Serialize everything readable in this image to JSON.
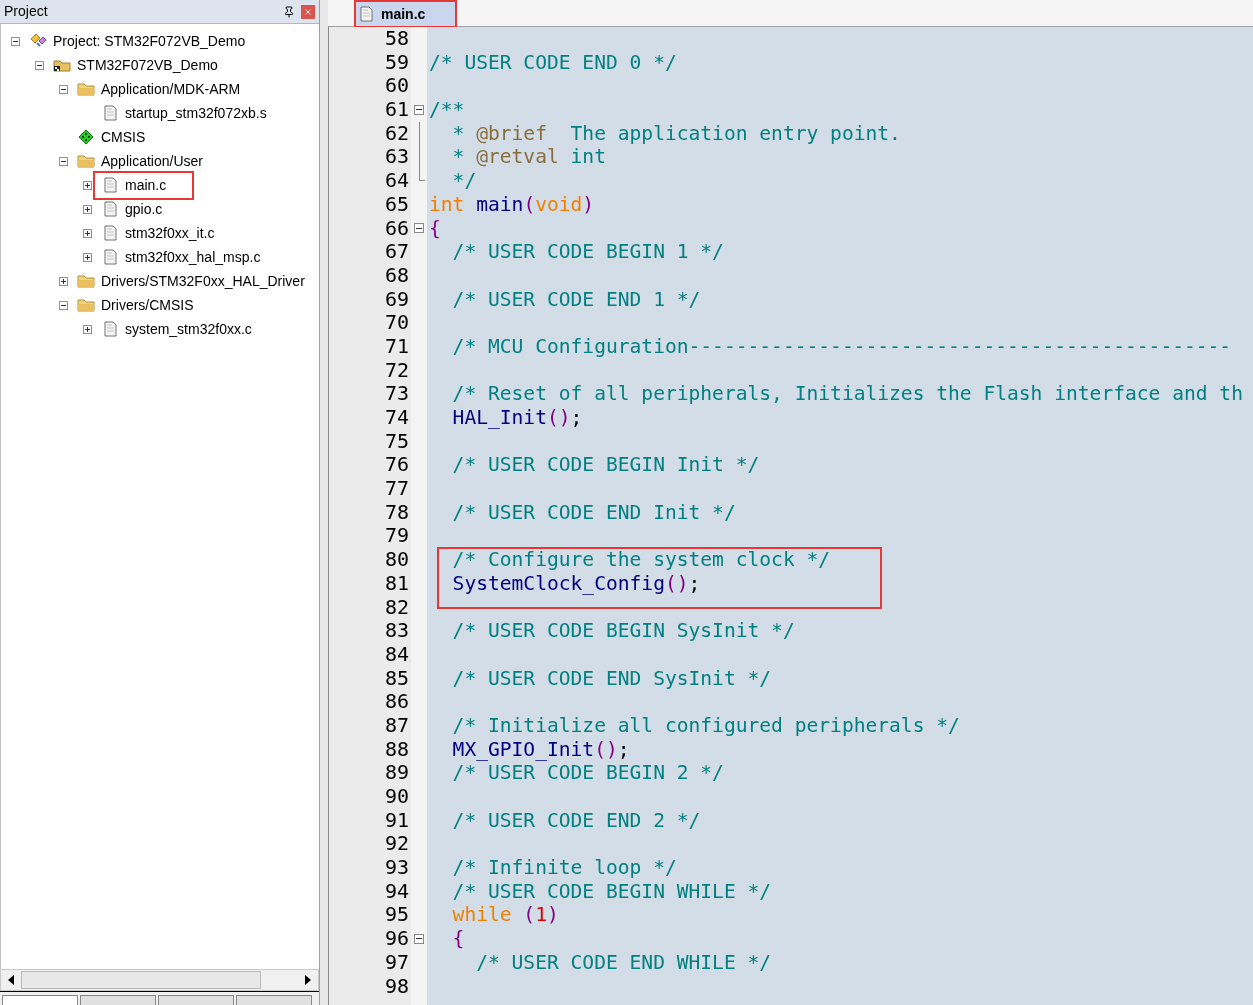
{
  "project_panel": {
    "title": "Project",
    "tree": [
      {
        "label": "Project: STM32F072VB_Demo",
        "kind": "project",
        "expanded": true,
        "children": [
          {
            "label": "STM32F072VB_Demo",
            "kind": "target",
            "expanded": true,
            "children": [
              {
                "label": "Application/MDK-ARM",
                "kind": "folder",
                "expanded": true,
                "children": [
                  {
                    "label": "startup_stm32f072xb.s",
                    "kind": "file"
                  }
                ]
              },
              {
                "label": "CMSIS",
                "kind": "component"
              },
              {
                "label": "Application/User",
                "kind": "folder",
                "expanded": true,
                "children": [
                  {
                    "label": "main.c",
                    "kind": "file",
                    "expanded": false,
                    "highlighted": true
                  },
                  {
                    "label": "gpio.c",
                    "kind": "file",
                    "expanded": false,
                    "highlighted": false
                  },
                  {
                    "label": "stm32f0xx_it.c",
                    "kind": "file",
                    "expanded": false,
                    "highlighted": false
                  },
                  {
                    "label": "stm32f0xx_hal_msp.c",
                    "kind": "file",
                    "expanded": false,
                    "highlighted": false
                  }
                ]
              },
              {
                "label": "Drivers/STM32F0xx_HAL_Driver",
                "kind": "folder",
                "expanded": false
              },
              {
                "label": "Drivers/CMSIS",
                "kind": "folder",
                "expanded": true,
                "children": [
                  {
                    "label": "system_stm32f0xx.c",
                    "kind": "file",
                    "expanded": false
                  }
                ]
              }
            ]
          }
        ]
      }
    ],
    "bottom_tabs": [
      {
        "selected": true
      },
      {
        "selected": false
      },
      {
        "selected": false
      },
      {
        "selected": false
      }
    ]
  },
  "editor": {
    "tabs": [
      {
        "label": "main.c",
        "selected": true,
        "highlighted": true
      }
    ],
    "lines": [
      {
        "number": "58"
      },
      {
        "number": "59",
        "segments": [
          {
            "kind": "comment",
            "text": "/* USER CODE END 0 */"
          }
        ]
      },
      {
        "number": "60"
      },
      {
        "number": "61",
        "fold_start": true,
        "segments": [
          {
            "kind": "comment",
            "text": "/**"
          }
        ]
      },
      {
        "number": "62",
        "fold_line": true,
        "segments": [
          {
            "kind": "comment",
            "text": "  * "
          },
          {
            "kind": "doctag",
            "text": "@brief"
          },
          {
            "kind": "comment",
            "text": "  The application entry point."
          }
        ]
      },
      {
        "number": "63",
        "fold_line": true,
        "segments": [
          {
            "kind": "comment",
            "text": "  * "
          },
          {
            "kind": "doctag",
            "text": "@retval"
          },
          {
            "kind": "comment",
            "text": " int"
          }
        ]
      },
      {
        "number": "64",
        "fold_end": true,
        "segments": [
          {
            "kind": "comment",
            "text": "  */"
          }
        ]
      },
      {
        "number": "65",
        "segments": [
          {
            "kind": "keyword",
            "text": "int"
          },
          {
            "kind": "function",
            "text": " main"
          },
          {
            "kind": "punct",
            "text": "("
          },
          {
            "kind": "keyword",
            "text": "void"
          },
          {
            "kind": "punct",
            "text": ")"
          }
        ]
      },
      {
        "number": "66",
        "fold_start": true,
        "segments": [
          {
            "kind": "punct",
            "text": "{"
          }
        ]
      },
      {
        "number": "67",
        "segments": [
          {
            "kind": "comment",
            "text": "  /* USER CODE BEGIN 1 */"
          }
        ]
      },
      {
        "number": "68"
      },
      {
        "number": "69",
        "segments": [
          {
            "kind": "comment",
            "text": "  /* USER CODE END 1 */"
          }
        ]
      },
      {
        "number": "70"
      },
      {
        "number": "71",
        "segments": [
          {
            "kind": "comment",
            "text": "  /* MCU Configuration----------------------------------------------"
          }
        ]
      },
      {
        "number": "72"
      },
      {
        "number": "73",
        "segments": [
          {
            "kind": "comment",
            "text": "  /* Reset of all peripherals, Initializes the Flash interface and th"
          }
        ]
      },
      {
        "number": "74",
        "segments": [
          {
            "kind": "function",
            "text": "  HAL_Init"
          },
          {
            "kind": "punct",
            "text": "()"
          },
          {
            "kind": "plain",
            "text": ";"
          }
        ]
      },
      {
        "number": "75"
      },
      {
        "number": "76",
        "segments": [
          {
            "kind": "comment",
            "text": "  /* USER CODE BEGIN Init */"
          }
        ]
      },
      {
        "number": "77"
      },
      {
        "number": "78",
        "segments": [
          {
            "kind": "comment",
            "text": "  /* USER CODE END Init */"
          }
        ]
      },
      {
        "number": "79"
      },
      {
        "number": "80",
        "highlighted": true,
        "segments": [
          {
            "kind": "comment",
            "text": "  /* Configure the system clock */"
          }
        ]
      },
      {
        "number": "81",
        "highlighted": true,
        "segments": [
          {
            "kind": "function",
            "text": "  SystemClock_Config"
          },
          {
            "kind": "punct",
            "text": "()"
          },
          {
            "kind": "plain",
            "text": ";"
          }
        ]
      },
      {
        "number": "82"
      },
      {
        "number": "83",
        "segments": [
          {
            "kind": "comment",
            "text": "  /* USER CODE BEGIN SysInit */"
          }
        ]
      },
      {
        "number": "84"
      },
      {
        "number": "85",
        "segments": [
          {
            "kind": "comment",
            "text": "  /* USER CODE END SysInit */"
          }
        ]
      },
      {
        "number": "86"
      },
      {
        "number": "87",
        "segments": [
          {
            "kind": "comment",
            "text": "  /* Initialize all configured peripherals */"
          }
        ]
      },
      {
        "number": "88",
        "segments": [
          {
            "kind": "function",
            "text": "  MX_GPIO_Init"
          },
          {
            "kind": "punct",
            "text": "()"
          },
          {
            "kind": "plain",
            "text": ";"
          }
        ]
      },
      {
        "number": "89",
        "segments": [
          {
            "kind": "comment",
            "text": "  /* USER CODE BEGIN 2 */"
          }
        ]
      },
      {
        "number": "90"
      },
      {
        "number": "91",
        "segments": [
          {
            "kind": "comment",
            "text": "  /* USER CODE END 2 */"
          }
        ]
      },
      {
        "number": "92"
      },
      {
        "number": "93",
        "segments": [
          {
            "kind": "comment",
            "text": "  /* Infinite loop */"
          }
        ]
      },
      {
        "number": "94",
        "segments": [
          {
            "kind": "comment",
            "text": "  /* USER CODE BEGIN WHILE */"
          }
        ]
      },
      {
        "number": "95",
        "segments": [
          {
            "kind": "keyword",
            "text": "  while"
          },
          {
            "kind": "punct",
            "text": " ("
          },
          {
            "kind": "number",
            "text": "1"
          },
          {
            "kind": "punct",
            "text": ")"
          }
        ]
      },
      {
        "number": "96",
        "fold_start": true,
        "segments": [
          {
            "kind": "punct",
            "text": "  {"
          }
        ]
      },
      {
        "number": "97",
        "segments": [
          {
            "kind": "comment",
            "text": "    /* USER CODE END WHILE */"
          }
        ]
      },
      {
        "number": "98"
      }
    ]
  }
}
